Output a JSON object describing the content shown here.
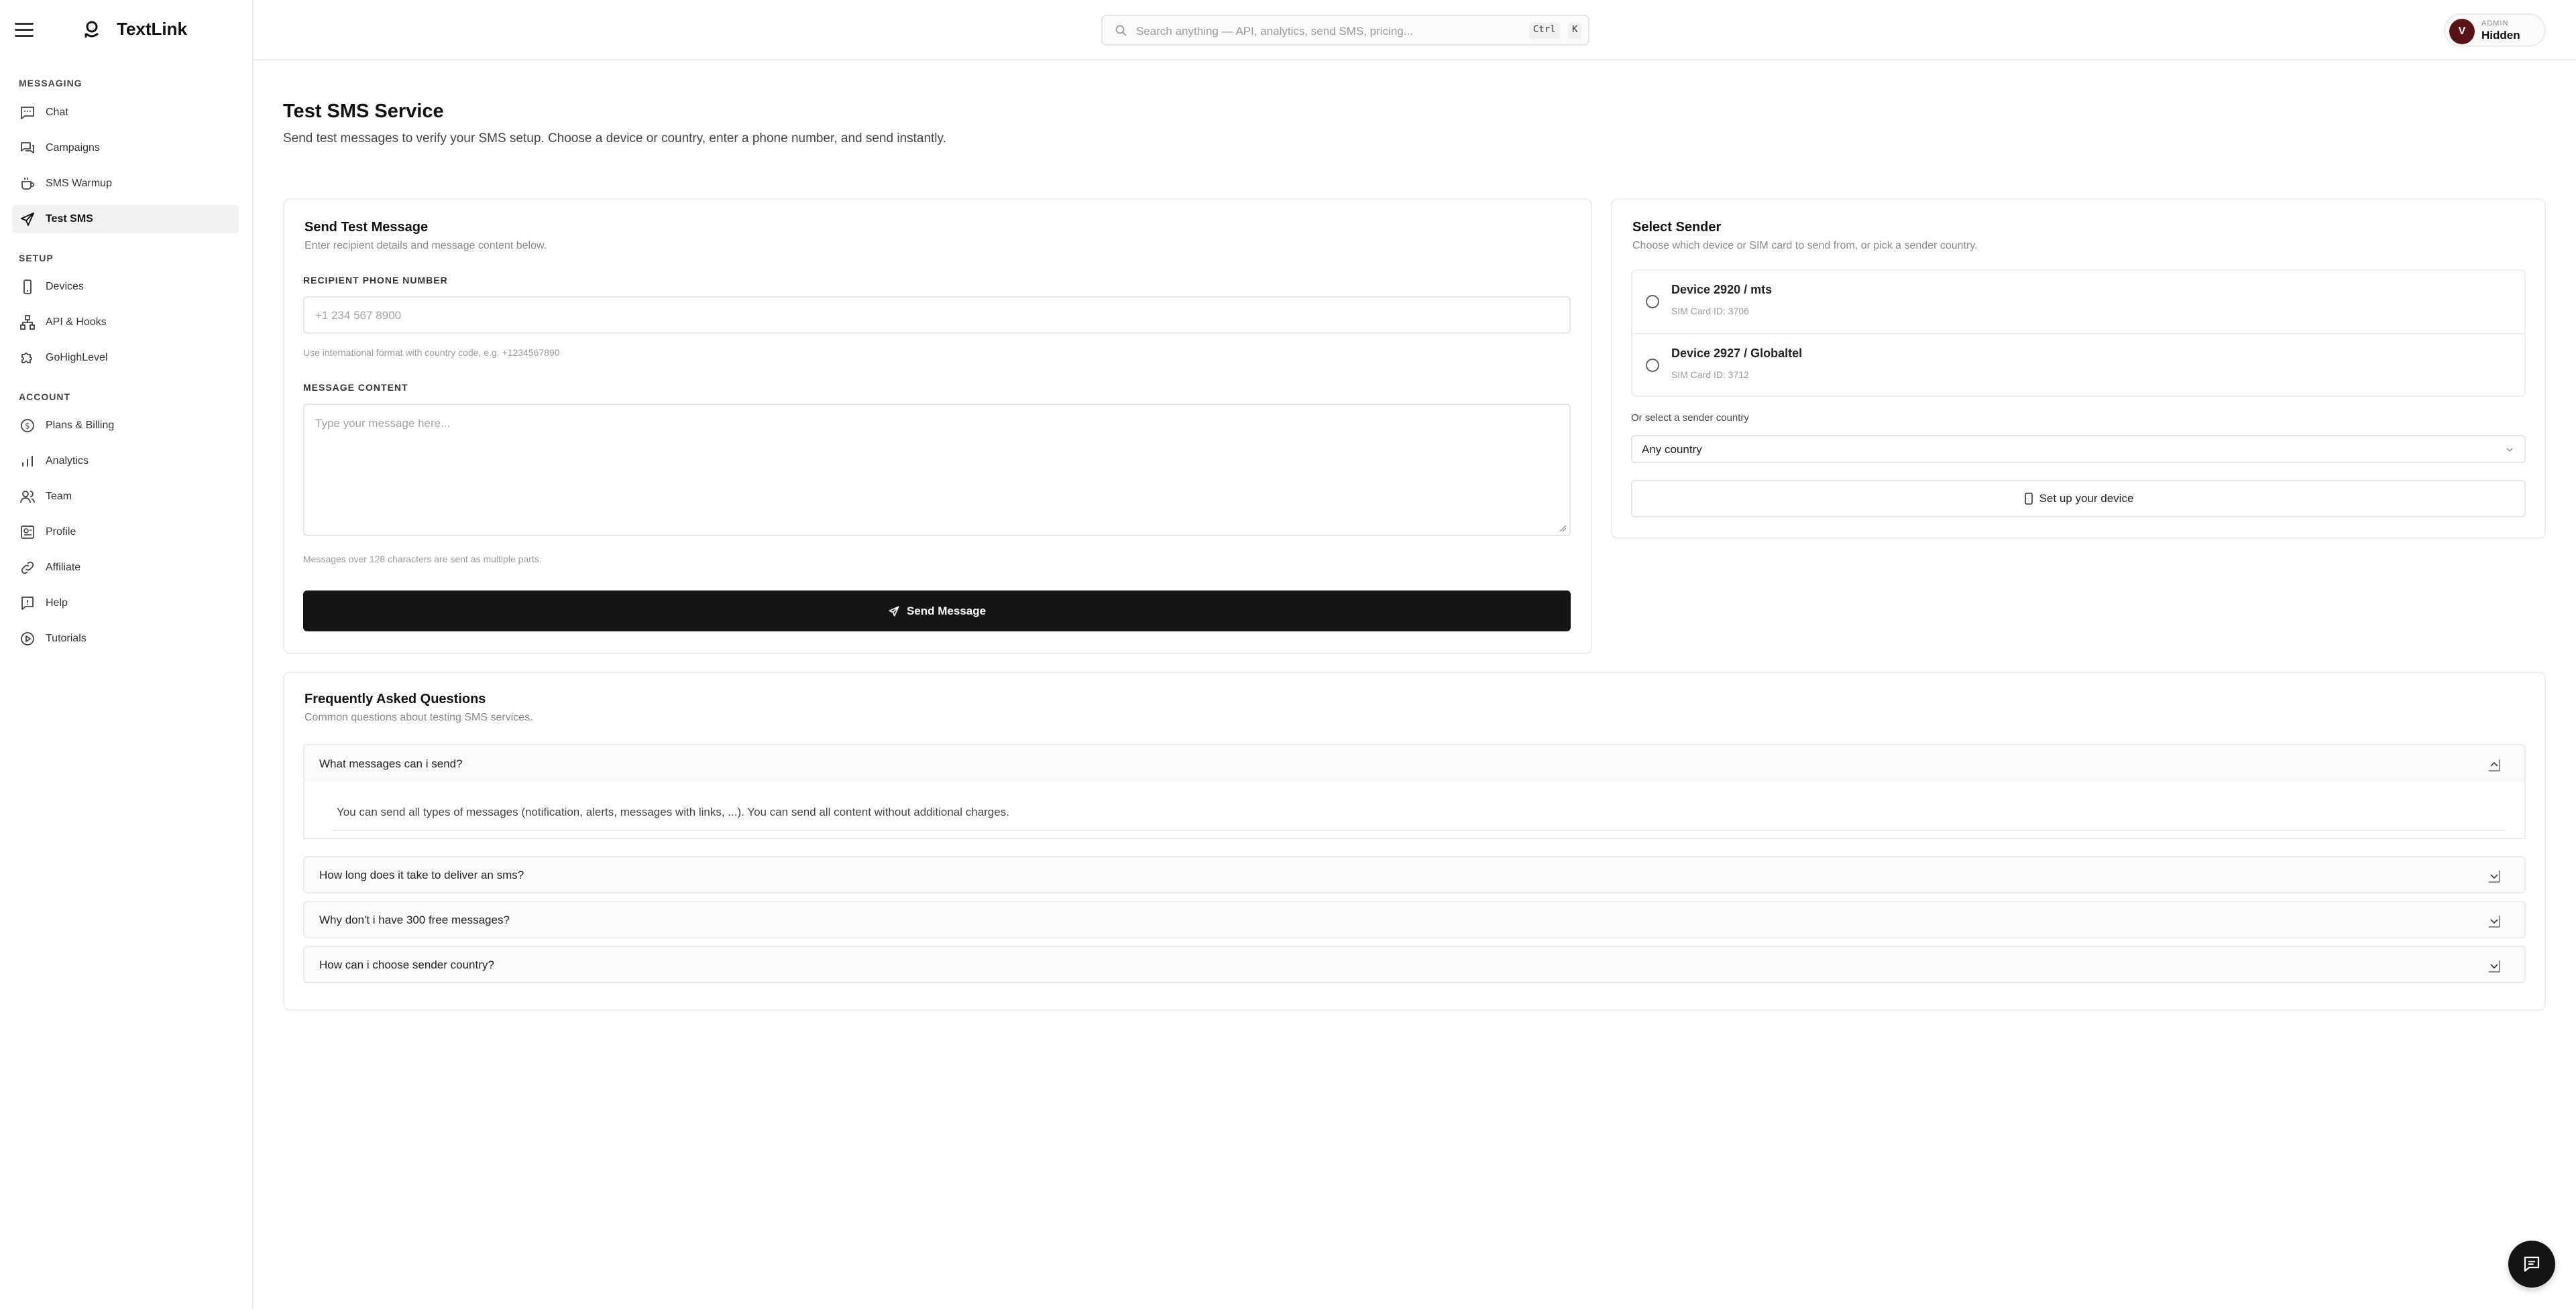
{
  "app": {
    "name": "TextLink"
  },
  "search": {
    "placeholder": "Search anything — API, analytics, send SMS, pricing...",
    "shortcut_ctrl": "Ctrl",
    "shortcut_key": "K"
  },
  "user": {
    "initial": "V",
    "role": "ADMIN",
    "name": "Hidden"
  },
  "sidebar": {
    "sections": [
      {
        "label": "MESSAGING"
      },
      {
        "label": "SETUP"
      },
      {
        "label": "ACCOUNT"
      }
    ],
    "items": [
      {
        "label": "Chat",
        "icon": "chat-icon"
      },
      {
        "label": "Campaigns",
        "icon": "campaigns-icon"
      },
      {
        "label": "SMS Warmup",
        "icon": "cup-icon"
      },
      {
        "label": "Test SMS",
        "icon": "send-icon",
        "active": true
      },
      {
        "label": "Devices",
        "icon": "phone-icon"
      },
      {
        "label": "API & Hooks",
        "icon": "network-icon"
      },
      {
        "label": "GoHighLevel",
        "icon": "puzzle-icon"
      },
      {
        "label": "Plans & Billing",
        "icon": "dollar-icon"
      },
      {
        "label": "Analytics",
        "icon": "bar-chart-icon"
      },
      {
        "label": "Team",
        "icon": "users-icon"
      },
      {
        "label": "Profile",
        "icon": "profile-icon"
      },
      {
        "label": "Affiliate",
        "icon": "link-icon"
      },
      {
        "label": "Help",
        "icon": "help-icon"
      },
      {
        "label": "Tutorials",
        "icon": "play-icon"
      }
    ]
  },
  "page": {
    "title": "Test SMS Service",
    "description": "Send test messages to verify your SMS setup. Choose a device or country, enter a phone number, and send instantly."
  },
  "send_card": {
    "title": "Send Test Message",
    "subtitle": "Enter recipient details and message content below.",
    "phone_label": "RECIPIENT PHONE NUMBER",
    "phone_placeholder": "+1 234 567 8900",
    "phone_hint": "Use international format with country code, e.g. +1234567890",
    "message_label": "MESSAGE CONTENT",
    "message_placeholder": "Type your message here...",
    "message_hint": "Messages over 128 characters are sent as multiple parts.",
    "send_label": "Send Message"
  },
  "sender_card": {
    "title": "Select Sender",
    "subtitle": "Choose which device or SIM card to send from, or pick a sender country.",
    "devices": [
      {
        "name": "Device 2920 / mts",
        "sim": "SIM Card ID: 3706"
      },
      {
        "name": "Device 2927 / Globaltel",
        "sim": "SIM Card ID: 3712"
      }
    ],
    "country_label": "Or select a sender country",
    "country_value": "Any country",
    "setup_label": "Set up your device"
  },
  "faq": {
    "title": "Frequently Asked Questions",
    "subtitle": "Common questions about testing SMS services.",
    "items": [
      {
        "q": "What messages can i send?",
        "a": "You can send all types of messages (notification, alerts, messages with links, ...). You can send all content without additional charges.",
        "open": true
      },
      {
        "q": "How long does it take to deliver an sms?"
      },
      {
        "q": "Why don't i have 300 free messages?"
      },
      {
        "q": "How can i choose sender country?"
      }
    ]
  }
}
